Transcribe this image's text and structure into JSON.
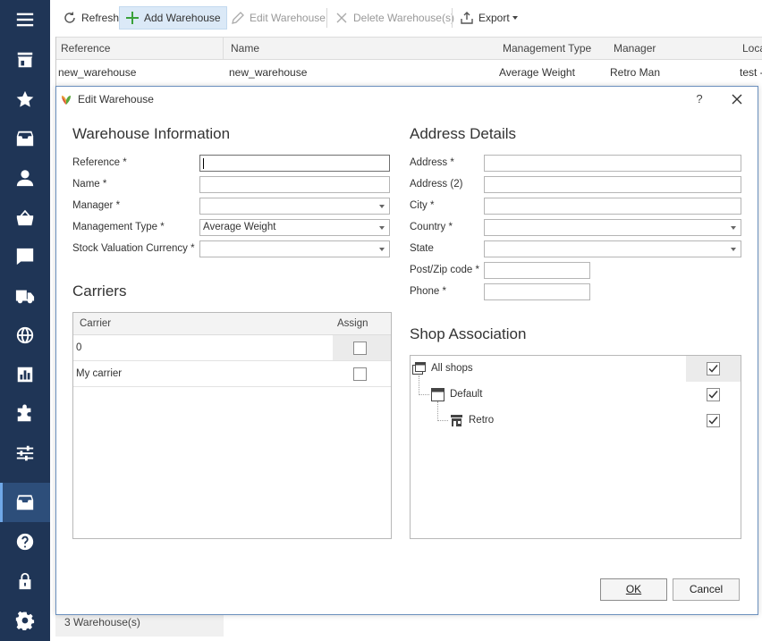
{
  "toolbar": {
    "refresh": "Refresh",
    "add": "Add Warehouse",
    "edit": "Edit Warehouse",
    "delete": "Delete Warehouse(s)",
    "export": "Export"
  },
  "grid": {
    "columns": [
      "Reference",
      "Name",
      "Management Type",
      "Manager",
      "Loca"
    ],
    "row": {
      "reference": "new_warehouse",
      "name": "new_warehouse",
      "management_type": "Average Weight",
      "manager": "Retro Man",
      "location": "test -"
    }
  },
  "status": {
    "count": "3 Warehouse(s)"
  },
  "dialog": {
    "title": "Edit Warehouse",
    "help": "?",
    "warehouse_info": {
      "title": "Warehouse Information",
      "reference_label": "Reference *",
      "reference_value": "",
      "name_label": "Name *",
      "name_value": "",
      "manager_label": "Manager *",
      "manager_value": "",
      "management_type_label": "Management Type *",
      "management_type_value": "Average Weight",
      "currency_label": "Stock Valuation Currency *",
      "currency_value": ""
    },
    "address": {
      "title": "Address Details",
      "address_label": "Address *",
      "address2_label": "Address (2)",
      "city_label": "City *",
      "country_label": "Country *",
      "state_label": "State",
      "zip_label": "Post/Zip code *",
      "phone_label": "Phone *"
    },
    "carriers": {
      "title": "Carriers",
      "col_carrier": "Carrier",
      "col_assign": "Assign",
      "rows": [
        {
          "name": "0",
          "assigned": false
        },
        {
          "name": "My carrier",
          "assigned": false
        }
      ]
    },
    "shops": {
      "title": "Shop Association",
      "items": [
        {
          "name": "All shops",
          "checked": true
        },
        {
          "name": "Default",
          "checked": true
        },
        {
          "name": "Retro",
          "checked": true
        }
      ]
    },
    "ok_label": "OK",
    "cancel_label": "Cancel"
  },
  "colors": {
    "sidebar": "#1f3556",
    "sidebar_active": "#2d4e7a",
    "dialog_border": "#6a8fbd",
    "add_button_bg": "#dbe9f7",
    "add_icon": "#3aa13a"
  },
  "sidebar_icons": [
    "menu-icon",
    "store-icon",
    "star-icon",
    "inbox-icon",
    "user-icon",
    "basket-icon",
    "message-icon",
    "truck-icon",
    "globe-icon",
    "chart-icon",
    "puzzle-icon",
    "sliders-icon",
    "warehouse-icon",
    "help-icon",
    "lock-icon",
    "gear-icon"
  ]
}
